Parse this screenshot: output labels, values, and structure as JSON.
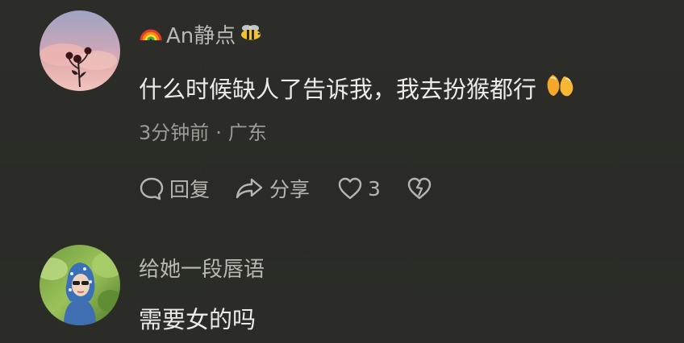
{
  "comments": [
    {
      "username": "An静点",
      "username_prefix_icon": "rainbow-icon",
      "username_suffix_icon": "bee-icon",
      "text": "什么时候缺人了告诉我，我去扮猴都行",
      "text_emoji": "cheers-emoji",
      "time": "3分钟前",
      "separator": "·",
      "location": "广东",
      "actions": {
        "reply_label": "回复",
        "share_label": "分享",
        "like_count": "3"
      }
    },
    {
      "username": "给她一段唇语",
      "text": "需要女的吗"
    }
  ],
  "colors": {
    "background": "#2b2c27",
    "username": "#b9b8b2",
    "text": "#ecebe6",
    "meta": "#9c9b95"
  }
}
